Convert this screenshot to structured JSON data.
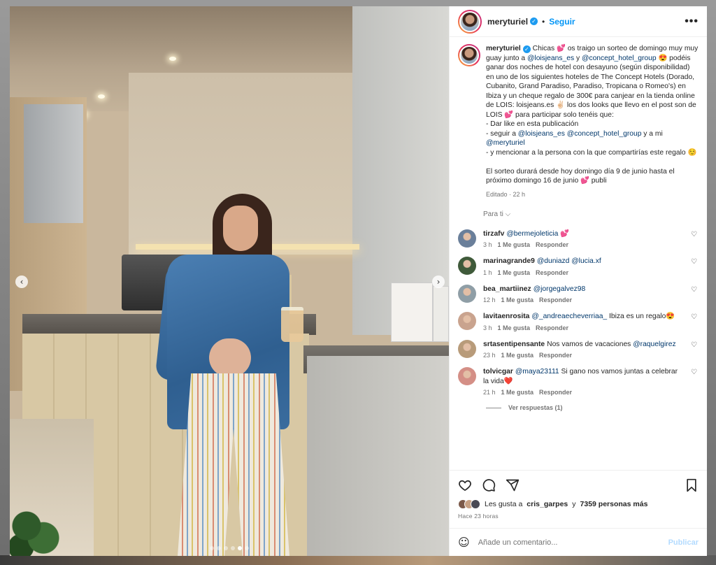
{
  "post": {
    "username": "meryturiel",
    "follow_label": "Seguir",
    "separator": "•",
    "more_label": "•••",
    "verified_glyph": "✓",
    "caption": {
      "t1": "Chicas 💕 os traigo un sorteo de domingo muy muy guay junto a ",
      "m1": "@loisjeans_es",
      "t2": " y ",
      "m2": "@concept_hotel_group",
      "t3": " 😍 podéis ganar dos noches de hotel con desayuno (según disponibilidad) en uno de los siguientes hoteles de The Concept Hotels (Dorado, Cubanito, Grand Paradiso, Paradiso, Tropicana o Romeo's) en Ibiza y un cheque regalo de 300€ para canjear en la tienda online de LOIS: loisjeans.es ✌🏻 los dos looks que llevo en el post son de LOIS 💕 para participar solo tenéis que:\n- Dar like en esta publicación\n- seguir a ",
      "m3": "@loisjeans_es",
      "t4": " ",
      "m4": "@concept_hotel_group",
      "t5": " y a mi ",
      "m5": "@meryturiel",
      "t6": "\n- y mencionar a la persona con la que compartirías este regalo ☺️\n\nEl sorteo durará desde hoy domingo día 9 de junio hasta el próximo domingo 16 de junio 💕 publi"
    },
    "edited_meta": "Editado · 22 h",
    "sort_label": "Para ti ⌵"
  },
  "comments": [
    {
      "user": "tirzafv",
      "mention": "@bermejoleticia",
      "text": " 💕",
      "time": "3 h",
      "likes": "1 Me gusta",
      "reply": "Responder",
      "avatar": "#6a7f9a"
    },
    {
      "user": "marinagrande9",
      "mention": "@duniazd @lucia.xf",
      "text": "",
      "time": "1 h",
      "likes": "1 Me gusta",
      "reply": "Responder",
      "avatar": "#3f5a3a"
    },
    {
      "user": "bea_martiinez",
      "mention": "@jorgegalvez98",
      "text": "",
      "time": "12 h",
      "likes": "1 Me gusta",
      "reply": "Responder",
      "avatar": "#8f9ea6"
    },
    {
      "user": "lavitaenrosita",
      "mention": "@_andreaecheverriaa_",
      "text": " Ibiza es un regalo😍",
      "time": "3 h",
      "likes": "1 Me gusta",
      "reply": "Responder",
      "avatar": "#c9a38e"
    },
    {
      "user": "srtasentipensante",
      "mention": "",
      "text": "Nos vamos de vacaciones ",
      "mention_after": "@raquelgirez",
      "time": "23 h",
      "likes": "1 Me gusta",
      "reply": "Responder",
      "avatar": "#b89b7a"
    },
    {
      "user": "tolvicgar",
      "mention": "@maya23111",
      "text": " Si gano nos vamos juntas a celebrar la vida❤️",
      "time": "21 h",
      "likes": "1 Me gusta",
      "reply": "Responder",
      "avatar": "#d48f86"
    }
  ],
  "replies_label": "Ver respuestas (1)",
  "likes": {
    "prefix": "Les gusta a ",
    "user": "cris_garpes",
    "middle": " y ",
    "count": "7359 personas más"
  },
  "time_ago": "Hace 23 horas",
  "add_comment": {
    "placeholder": "Añade un comentario...",
    "publish_label": "Publicar",
    "emoji_icon": "☺"
  },
  "carousel": {
    "prev": "‹",
    "next": "›",
    "slides": 6,
    "active_index": 4
  },
  "icons": {
    "heart": "♡",
    "like_icon": "heart-icon",
    "comment_icon": "comment-icon",
    "share_icon": "share-icon",
    "save_icon": "bookmark-icon"
  },
  "colors": {
    "accent": "#0095f6",
    "mention": "#00376b",
    "muted": "#737373"
  }
}
